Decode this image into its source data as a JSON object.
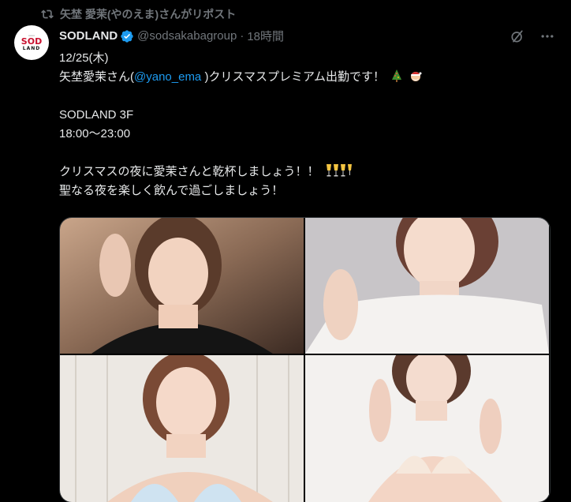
{
  "repost": {
    "text": "矢埜 愛茉(やのえま)さんがリポスト",
    "icon": "repost-icon"
  },
  "avatar": {
    "logo_top": "SOD",
    "logo_bottom": "LAND",
    "brand_color": "#c8102e"
  },
  "header": {
    "display_name": "SODLAND",
    "handle": "@sodsakabagroup",
    "separator": "·",
    "time": "18時間",
    "verified_color": "#1d9bf0"
  },
  "tweet": {
    "line1": "12/25(木)",
    "line2_before": "矢埜愛茉さん(",
    "mention": "@yano_ema",
    "line2_after": " )クリスマスプレミアム出勤です！",
    "line3": "SODLAND 3F",
    "line4": "18:00～23:00",
    "line5": "クリスマスの夜に愛茉さんと乾杯しましょう！！",
    "line6": "聖なる夜を楽しく飲んで過ごしましょう！"
  },
  "emoji": {
    "tree": "christmas-tree-emoji",
    "santa": "santa-face-emoji",
    "glasses": "clinking-glasses-emoji"
  },
  "media": {
    "photos": [
      {
        "label": "photo-1",
        "tone": "black top, warm background"
      },
      {
        "label": "photo-2",
        "tone": "white top, grey background"
      },
      {
        "label": "photo-3",
        "tone": "light blue bikini, white wood background"
      },
      {
        "label": "photo-4",
        "tone": "lace lingerie, white background"
      }
    ]
  },
  "colors": {
    "background": "#000000",
    "text": "#e7e9ea",
    "muted": "#71767b",
    "accent": "#1d9bf0"
  }
}
